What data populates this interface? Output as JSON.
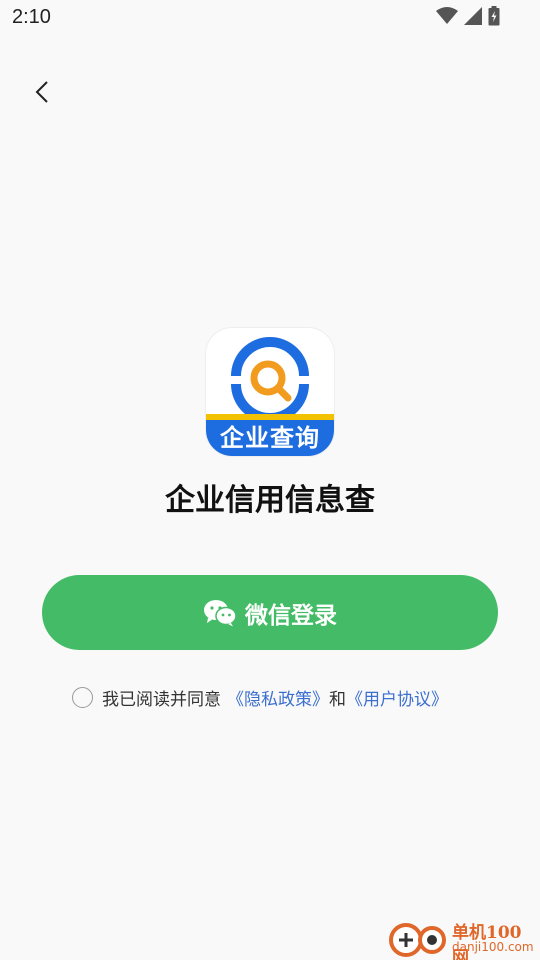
{
  "status_bar": {
    "time": "2:10",
    "icons": [
      "wifi-icon",
      "signal-icon",
      "battery-icon"
    ]
  },
  "nav": {
    "back_icon": "chevron-left-icon"
  },
  "app": {
    "logo_text": "企业查询",
    "name": "企业信用信息查"
  },
  "login": {
    "label": "微信登录",
    "icon": "wechat-icon",
    "color": "#44bb66"
  },
  "agreement": {
    "prefix": "我已阅读并同意",
    "privacy_link": "《隐私政策》",
    "conjunction": "和",
    "terms_link": "《用户协议》",
    "checked": false
  },
  "watermark": {
    "title": "单机100网",
    "url": "danji100.com"
  },
  "colors": {
    "background": "#f9f9f9",
    "accent_green": "#44bb66",
    "link_blue": "#3b6fcf",
    "logo_blue": "#1e6de0",
    "logo_yellow": "#f2c200"
  }
}
